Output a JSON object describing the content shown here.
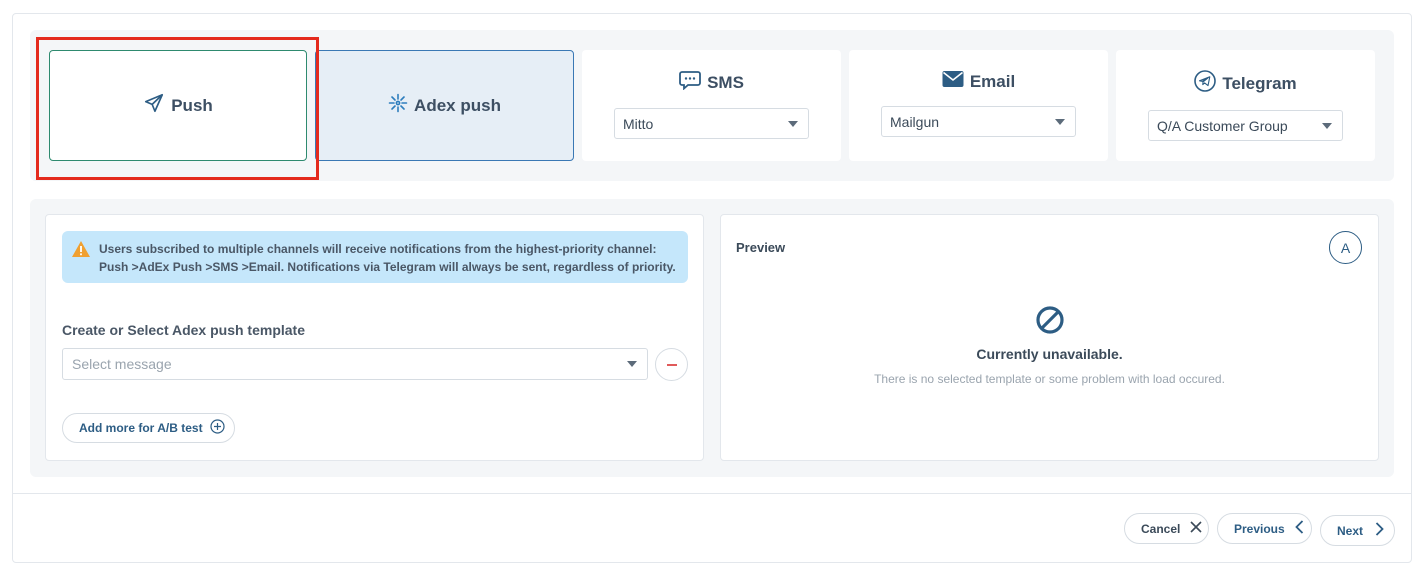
{
  "channels": {
    "push": {
      "label": "Push",
      "icon": "send-icon"
    },
    "adex_push": {
      "label": "Adex push",
      "icon": "sparkle-icon"
    },
    "sms": {
      "label": "SMS",
      "icon": "chat-icon",
      "provider": "Mitto"
    },
    "email": {
      "label": "Email",
      "icon": "envelope-icon",
      "provider": "Mailgun"
    },
    "telegram": {
      "label": "Telegram",
      "icon": "telegram-icon",
      "provider": "Q/A Customer Group"
    }
  },
  "alert": {
    "text": "Users subscribed to multiple channels will receive notifications from the highest-priority channel: Push >AdEx Push >SMS >Email. Notifications via Telegram will always be sent, regardless of priority."
  },
  "template": {
    "label": "Create or Select Adex push template",
    "placeholder": "Select message",
    "add_ab_label": "Add more for A/B test"
  },
  "preview": {
    "title": "Preview",
    "avatar_letter": "A",
    "unavailable_title": "Currently unavailable.",
    "unavailable_sub": "There is no selected template or some problem with load occured."
  },
  "footer": {
    "cancel_label": "Cancel",
    "previous_label": "Previous",
    "next_label": "Next"
  },
  "colors": {
    "accent": "#2d5d84",
    "highlight": "#e42a1d",
    "alert_bg": "#c5e7fb",
    "warning": "#f0a030",
    "danger": "#e05a5a"
  }
}
